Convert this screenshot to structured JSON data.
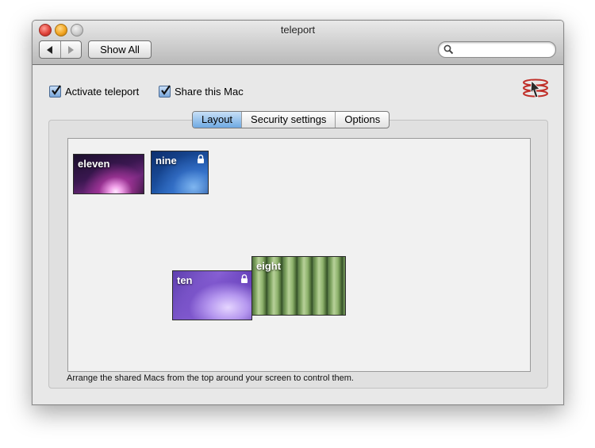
{
  "window": {
    "title": "teleport"
  },
  "toolbar": {
    "show_all_label": "Show All",
    "search_placeholder": ""
  },
  "options": {
    "activate": {
      "label": "Activate teleport",
      "checked": true
    },
    "share": {
      "label": "Share this Mac",
      "checked": true
    }
  },
  "tabs": [
    {
      "label": "Layout",
      "active": true
    },
    {
      "label": "Security settings",
      "active": false
    },
    {
      "label": "Options",
      "active": false
    }
  ],
  "shelf": {
    "macs": [
      {
        "name": "eleven",
        "locked": false
      },
      {
        "name": "nine",
        "locked": true
      }
    ]
  },
  "arrangement": {
    "macs": [
      {
        "name": "ten",
        "locked": true
      },
      {
        "name": "eight",
        "locked": false
      }
    ]
  },
  "hint_text": "Arrange the shared Macs from the top around your screen to control them.",
  "icons": [
    "close-icon",
    "minimize-icon",
    "zoom-icon",
    "back-arrow-icon",
    "forward-arrow-icon",
    "search-icon",
    "checkmark-icon",
    "teleport-app-icon",
    "lock-icon"
  ],
  "colors": {
    "tab_active": "#6fa9e3",
    "checkbox": "#7aa7da"
  }
}
